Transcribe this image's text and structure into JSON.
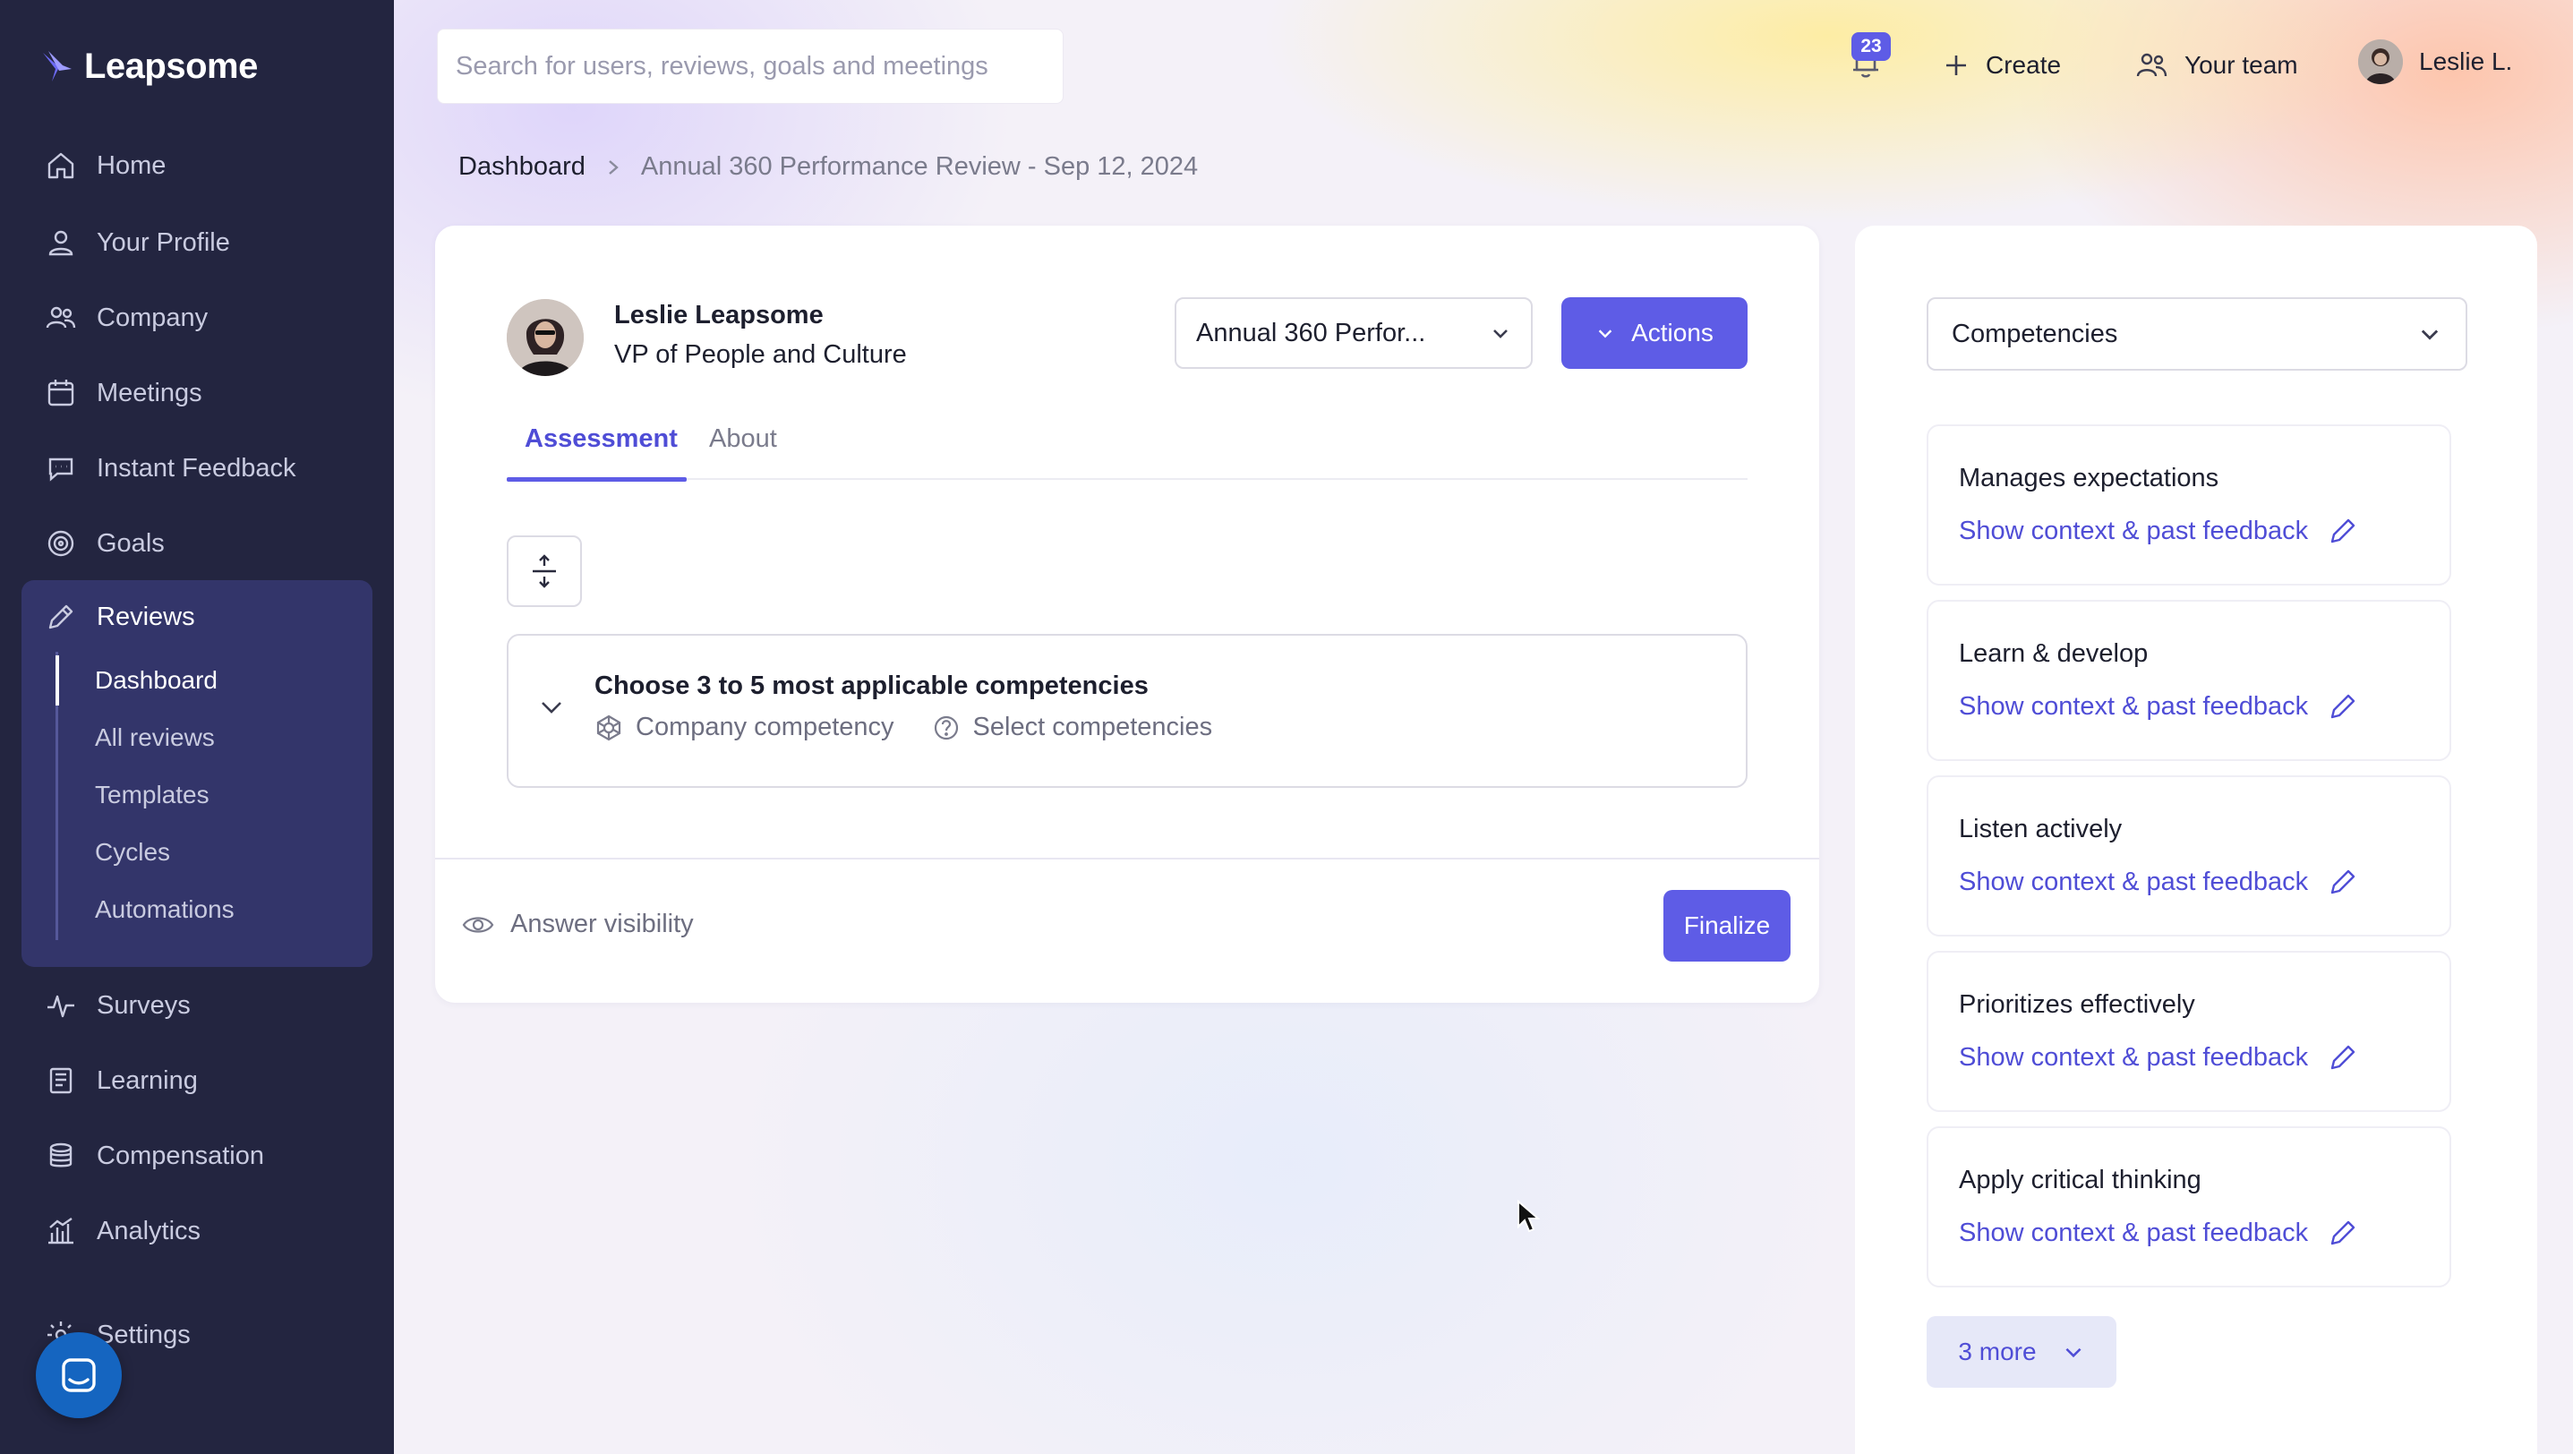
{
  "app": {
    "logo_text": "Leapsome"
  },
  "sidebar": {
    "items": [
      {
        "label": "Home",
        "icon": "home-icon"
      },
      {
        "label": "Your Profile",
        "icon": "user-icon"
      },
      {
        "label": "Company",
        "icon": "users-icon"
      },
      {
        "label": "Meetings",
        "icon": "calendar-icon"
      },
      {
        "label": "Instant Feedback",
        "icon": "chat-icon"
      },
      {
        "label": "Goals",
        "icon": "target-icon"
      },
      {
        "label": "Reviews",
        "icon": "pencil-icon"
      },
      {
        "label": "Surveys",
        "icon": "pulse-icon"
      },
      {
        "label": "Learning",
        "icon": "book-icon"
      },
      {
        "label": "Compensation",
        "icon": "coins-icon"
      },
      {
        "label": "Analytics",
        "icon": "chart-icon"
      },
      {
        "label": "Settings",
        "icon": "gear-icon"
      }
    ],
    "reviews_sub": [
      "Dashboard",
      "All reviews",
      "Templates",
      "Cycles",
      "Automations"
    ],
    "active_sub": "Dashboard"
  },
  "topbar": {
    "search_placeholder": "Search for users, reviews, goals and meetings",
    "notification_count": "23",
    "create_label": "Create",
    "team_label": "Your team",
    "user_label": "Leslie L."
  },
  "breadcrumb": {
    "root": "Dashboard",
    "current": "Annual 360 Performance Review - Sep 12, 2024"
  },
  "review": {
    "person_name": "Leslie Leapsome",
    "person_role": "VP of People and Culture",
    "review_select_value": "Annual 360 Perfor...",
    "actions_label": "Actions",
    "tabs": [
      {
        "label": "Assessment",
        "active": true
      },
      {
        "label": "About",
        "active": false
      }
    ],
    "competency_prompt": "Choose 3 to 5 most applicable competencies",
    "competency_type": "Company competency",
    "select_competencies": "Select competencies",
    "answer_visibility": "Answer visibility",
    "finalize_label": "Finalize"
  },
  "panel": {
    "select_value": "Competencies",
    "competencies": [
      {
        "name": "Manages expectations",
        "link": "Show context & past feedback"
      },
      {
        "name": "Learn & develop",
        "link": "Show context & past feedback"
      },
      {
        "name": "Listen actively",
        "link": "Show context & past feedback"
      },
      {
        "name": "Prioritizes effectively",
        "link": "Show context & past feedback"
      },
      {
        "name": "Apply critical thinking",
        "link": "Show context & past feedback"
      }
    ],
    "more_label": "3 more"
  },
  "colors": {
    "sidebar_bg": "#232540",
    "accent": "#5e5ce6",
    "link": "#4f4dd6"
  }
}
